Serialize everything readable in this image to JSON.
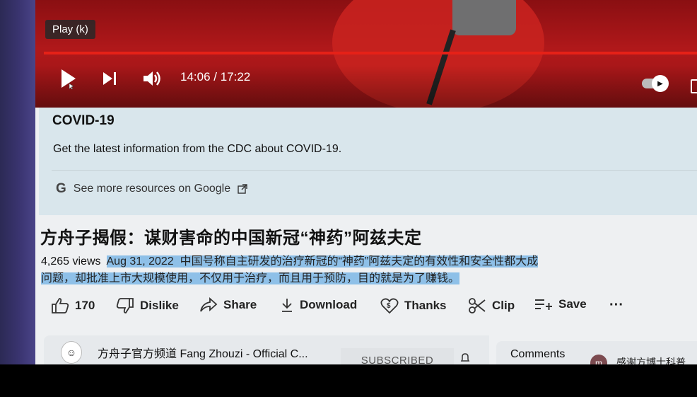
{
  "player": {
    "tooltip": "Play (k)",
    "time": "14:06 / 17:22",
    "progress_fraction": 0.82,
    "icons": [
      "play-icon",
      "next-icon",
      "volume-icon",
      "autoplay-toggle-icon",
      "miniplayer-icon"
    ]
  },
  "info_panel": {
    "title": "COVID-19",
    "description": "Get the latest information from the CDC about COVID-19.",
    "link_label": "See more resources on Google",
    "icons": [
      "google-g-icon",
      "external-link-icon"
    ]
  },
  "video": {
    "title": "方舟子揭假：谋财害命的中国新冠“神药”阿兹夫定",
    "views": "4,265 views",
    "date": "Aug 31, 2022",
    "desc_line1": "中国号称自主研发的治疗新冠的“神药”阿兹夫定的有效性和安全性都大成",
    "desc_line2": "问题，却批准上市大规模使用，不仅用于治疗，而且用于预防，目的就是为了赚钱。"
  },
  "actions": {
    "like_count": "170",
    "dislike": "Dislike",
    "share": "Share",
    "download": "Download",
    "thanks": "Thanks",
    "clip": "Clip",
    "save": "Save",
    "more": "···"
  },
  "channel": {
    "name": "方舟子官方频道 Fang Zhouzi - Official C...",
    "subscribe_label": "SUBSCRIBED"
  },
  "comments": {
    "label": "Comments",
    "avatar_letter": "m",
    "preview": "感谢方博士科普"
  },
  "colors": {
    "progress": "#e62117",
    "highlight": "#8ec0e8",
    "info_bg": "#d9e6ec"
  }
}
